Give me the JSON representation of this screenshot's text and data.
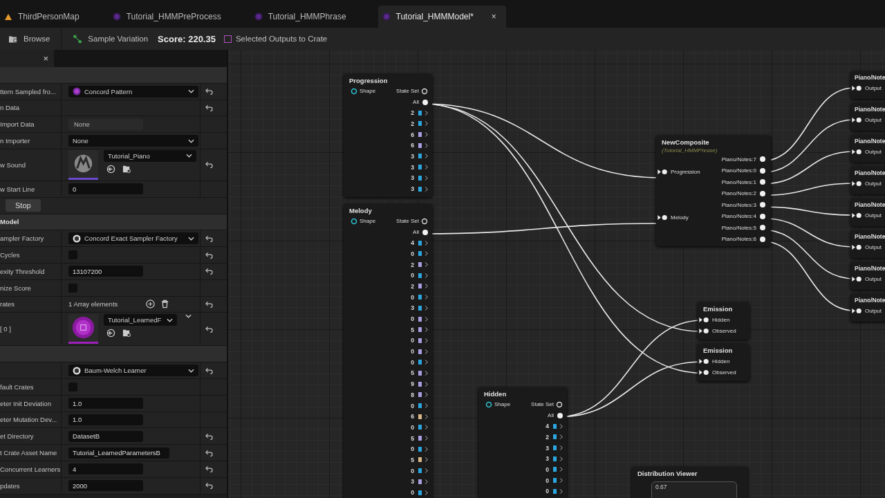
{
  "tabs": [
    {
      "label": "ThirdPersonMap",
      "kind": "map",
      "selected": false
    },
    {
      "label": "Tutorial_HMMPreProcess",
      "kind": "asset",
      "selected": false
    },
    {
      "label": "Tutorial_HMMPhrase",
      "kind": "asset",
      "selected": false
    },
    {
      "label": "Tutorial_HMMModel*",
      "kind": "asset",
      "selected": true
    }
  ],
  "tab_close": "×",
  "toolbar": {
    "browse": "Browse",
    "sample": "Sample Variation",
    "score": "Score: 220.35",
    "crate_option": {
      "label": "Selected Outputs to Crate",
      "checked": false
    }
  },
  "details": {
    "close": "×",
    "rows": [
      {
        "kind": "section",
        "label": ""
      },
      {
        "kind": "pattern_dropdown",
        "label": "ttern Sampled fro...",
        "value": "Concord Pattern",
        "resettable": true
      },
      {
        "kind": "empty",
        "label": "n Data",
        "resettable": true
      },
      {
        "kind": "readonly",
        "label": "Import Data",
        "value": "None",
        "resettable": false
      },
      {
        "kind": "dropdown",
        "label": "n Importer",
        "value": "None",
        "resettable": false
      },
      {
        "kind": "sound_asset",
        "label": "w Sound",
        "value": "Tutorial_Piano",
        "resettable": true
      },
      {
        "kind": "input",
        "label": "w Start Line",
        "value": "0",
        "resettable": false
      },
      {
        "kind": "button",
        "label": "Stop"
      },
      {
        "kind": "section",
        "label": "Model"
      },
      {
        "kind": "factory_dropdown",
        "label": "ampler Factory",
        "value": "Concord Exact Sampler Factory",
        "resettable": true
      },
      {
        "kind": "checkbox",
        "label": "Cycles",
        "checked": false,
        "resettable": true
      },
      {
        "kind": "input",
        "label": "exity Threshold",
        "value": "13107200",
        "resettable": true
      },
      {
        "kind": "checkbox",
        "label": "nize Score",
        "checked": false,
        "resettable": false
      },
      {
        "kind": "array",
        "label": "rates",
        "value": "1 Array elements",
        "resettable": true
      },
      {
        "kind": "crate_asset",
        "label": "[ 0 ]",
        "value": "Tutorial_LearnedF",
        "resettable": true
      },
      {
        "kind": "section",
        "label": ""
      },
      {
        "kind": "factory_dropdown",
        "label": "",
        "value": "Baum-Welch Learner",
        "resettable": true
      },
      {
        "kind": "checkbox",
        "label": "fault Crates",
        "checked": false,
        "resettable": false
      },
      {
        "kind": "input",
        "label": "eter Init Deviation",
        "value": "1.0",
        "resettable": false
      },
      {
        "kind": "input",
        "label": "eter Mutation Dev...",
        "value": "1.0",
        "resettable": false
      },
      {
        "kind": "input",
        "label": "et Directory",
        "value": "DatasetB",
        "resettable": true
      },
      {
        "kind": "wide_input",
        "label": "t Crate Asset Name",
        "value": "Tutorial_LearnedParametersB",
        "resettable": true
      },
      {
        "kind": "input",
        "label": "Concurrent Learners",
        "value": "4",
        "resettable": true
      },
      {
        "kind": "input",
        "label": "pdates",
        "value": "2000",
        "resettable": true
      }
    ]
  },
  "graph": {
    "pattern_nodes": [
      {
        "title": "Progression",
        "shape": "Shape",
        "state_set": "State Set",
        "all": "All",
        "pins": [
          {
            "label": "2",
            "color": "#2aa7e0"
          },
          {
            "label": "2",
            "color": "#2aa7e0"
          },
          {
            "label": "6",
            "color": "#a99ee0"
          },
          {
            "label": "6",
            "color": "#a99ee0"
          },
          {
            "label": "3",
            "color": "#2aa7e0"
          },
          {
            "label": "3",
            "color": "#2aa7e0"
          },
          {
            "label": "3",
            "color": "#2aa7e0"
          },
          {
            "label": "3",
            "color": "#2aa7e0"
          }
        ]
      },
      {
        "title": "Melody",
        "shape": "Shape",
        "state_set": "State Set",
        "all": "All",
        "pins": [
          {
            "label": "4",
            "color": "#2aa7e0"
          },
          {
            "label": "0",
            "color": "#2aa7e0"
          },
          {
            "label": "2",
            "color": "#a99ee0"
          },
          {
            "label": "0",
            "color": "#2aa7e0"
          },
          {
            "label": "2",
            "color": "#a99ee0"
          },
          {
            "label": "0",
            "color": "#2aa7e0"
          },
          {
            "label": "3",
            "color": "#2aa7e0"
          },
          {
            "label": "0",
            "color": "#a99ee0"
          },
          {
            "label": "5",
            "color": "#a99ee0"
          },
          {
            "label": "0",
            "color": "#a99ee0"
          },
          {
            "label": "0",
            "color": "#a99ee0"
          },
          {
            "label": "0",
            "color": "#2aa7e0"
          },
          {
            "label": "5",
            "color": "#a99ee0"
          },
          {
            "label": "9",
            "color": "#a99ee0"
          },
          {
            "label": "8",
            "color": "#a99ee0"
          },
          {
            "label": "0",
            "color": "#2aa7e0"
          },
          {
            "label": "6",
            "color": "#d9b98a"
          },
          {
            "label": "0",
            "color": "#2aa7e0"
          },
          {
            "label": "5",
            "color": "#a99ee0"
          },
          {
            "label": "0",
            "color": "#2aa7e0"
          },
          {
            "label": "5",
            "color": "#d9b98a"
          },
          {
            "label": "0",
            "color": "#2aa7e0"
          },
          {
            "label": "3",
            "color": "#a99ee0"
          },
          {
            "label": "0",
            "color": "#2aa7e0"
          }
        ]
      },
      {
        "title": "Hidden",
        "shape": "Shape",
        "state_set": "State Set",
        "all": "All",
        "pins": [
          {
            "label": "4",
            "color": "#2aa7e0"
          },
          {
            "label": "2",
            "color": "#2aa7e0"
          },
          {
            "label": "3",
            "color": "#2aa7e0"
          },
          {
            "label": "3",
            "color": "#2aa7e0"
          },
          {
            "label": "0",
            "color": "#2aa7e0"
          },
          {
            "label": "0",
            "color": "#2aa7e0"
          },
          {
            "label": "0",
            "color": "#2aa7e0"
          }
        ]
      }
    ],
    "composite": {
      "title": "NewComposite",
      "subtitle": "(Tutorial_HMMPhrase)",
      "inputs": [
        "Progression",
        "Melody"
      ],
      "outputs": [
        "Piano/Notes:7",
        "Piano/Notes:0",
        "Piano/Notes:1",
        "Piano/Notes:2",
        "Piano/Notes:3",
        "Piano/Notes:4",
        "Piano/Notes:5",
        "Piano/Notes:6"
      ]
    },
    "output_nodes": [
      {
        "title": "Piano/Note",
        "pin": "Output"
      },
      {
        "title": "Piano/Note",
        "pin": "Output"
      },
      {
        "title": "Piano/Note",
        "pin": "Output"
      },
      {
        "title": "Piano/Note",
        "pin": "Output"
      },
      {
        "title": "Piano/Note",
        "pin": "Output"
      },
      {
        "title": "Piano/Note",
        "pin": "Output"
      },
      {
        "title": "Piano/Note",
        "pin": "Output"
      },
      {
        "title": "Piano/Note",
        "pin": "Output"
      }
    ],
    "emission_nodes": [
      {
        "title": "Emission",
        "inputs": [
          "Hidden",
          "Observed"
        ]
      },
      {
        "title": "Emission",
        "inputs": [
          "Hidden",
          "Observed"
        ]
      }
    ],
    "distribution_viewer": {
      "title": "Distribution Viewer",
      "reading": "0.67"
    }
  }
}
